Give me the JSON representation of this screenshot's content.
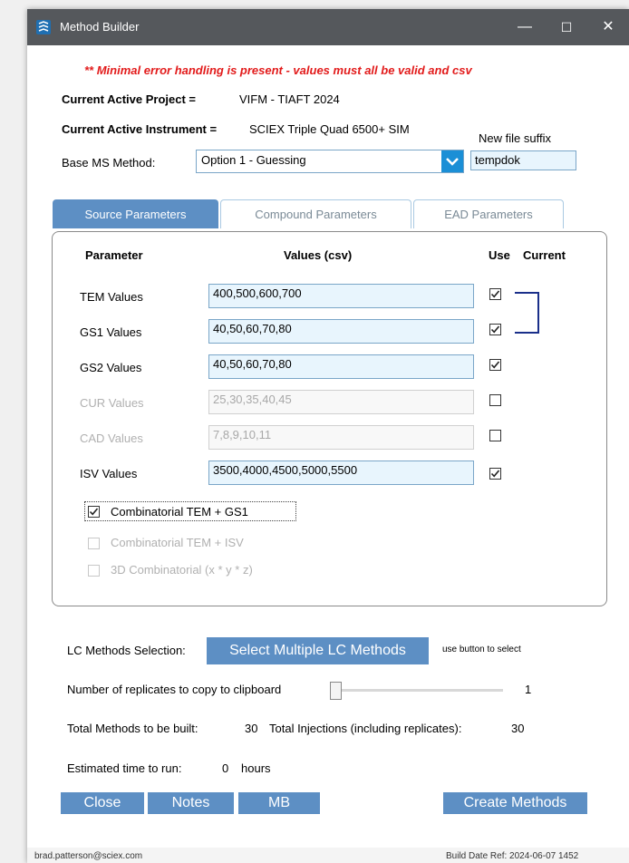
{
  "window": {
    "title": "Method Builder",
    "minimize": "—",
    "maximize": "☐",
    "close": "✕"
  },
  "warning": "** Minimal error handling is present - values must all be valid and csv",
  "project": {
    "label": "Current Active Project =",
    "value": "VIFM - TIAFT 2024"
  },
  "instrument": {
    "label": "Current Active Instrument =",
    "value": "SCIEX Triple Quad 6500+ SIM"
  },
  "base_method": {
    "label": "Base MS Method:",
    "selected": "Option 1 - Guessing"
  },
  "suffix": {
    "label": "New file suffix",
    "value": "tempdok"
  },
  "tabs": [
    {
      "label": "Source Parameters",
      "active": true
    },
    {
      "label": "Compound Parameters",
      "active": false
    },
    {
      "label": "EAD Parameters",
      "active": false
    }
  ],
  "table": {
    "headers": {
      "parameter": "Parameter",
      "values": "Values (csv)",
      "use": "Use",
      "current": "Current"
    },
    "rows": [
      {
        "name": "TEM Values",
        "values": "400,500,600,700",
        "use": true,
        "enabled": true
      },
      {
        "name": "GS1 Values",
        "values": "40,50,60,70,80",
        "use": true,
        "enabled": true
      },
      {
        "name": "GS2 Values",
        "values": "40,50,60,70,80",
        "use": true,
        "enabled": true
      },
      {
        "name": "CUR Values",
        "values": "25,30,35,40,45",
        "use": false,
        "enabled": false
      },
      {
        "name": "CAD Values",
        "values": "7,8,9,10,11",
        "use": false,
        "enabled": false
      },
      {
        "name": "ISV Values",
        "values": "3500,4000,4500,5000,5500",
        "use": true,
        "enabled": true
      }
    ]
  },
  "combinatorial": [
    {
      "label": "Combinatorial TEM + GS1",
      "checked": true,
      "enabled": true
    },
    {
      "label": "Combinatorial TEM + ISV",
      "checked": false,
      "enabled": false
    },
    {
      "label": "3D Combinatorial (x * y * z)",
      "checked": false,
      "enabled": false
    }
  ],
  "lc": {
    "label": "LC Methods Selection:",
    "button": "Select Multiple LC Methods",
    "hint": "use button to select"
  },
  "replicates": {
    "label": "Number of replicates to copy to clipboard",
    "value": "1"
  },
  "totals": {
    "methods_label": "Total Methods to be built:",
    "methods_value": "30",
    "injections_label": "Total Injections (including replicates):",
    "injections_value": "30"
  },
  "time": {
    "label": "Estimated time to run:",
    "value": "0",
    "unit": "hours"
  },
  "buttons": {
    "close": "Close",
    "notes": "Notes",
    "mb": "MB",
    "create": "Create Methods"
  },
  "footer": {
    "email": "brad.patterson@sciex.com",
    "build": "Build Date Ref: 2024-06-07 1452"
  },
  "colors": {
    "accent": "#5d8fc4",
    "warning": "#e21b1b",
    "input_bg": "#e8f5fd",
    "bracket": "#1a2f8a"
  }
}
